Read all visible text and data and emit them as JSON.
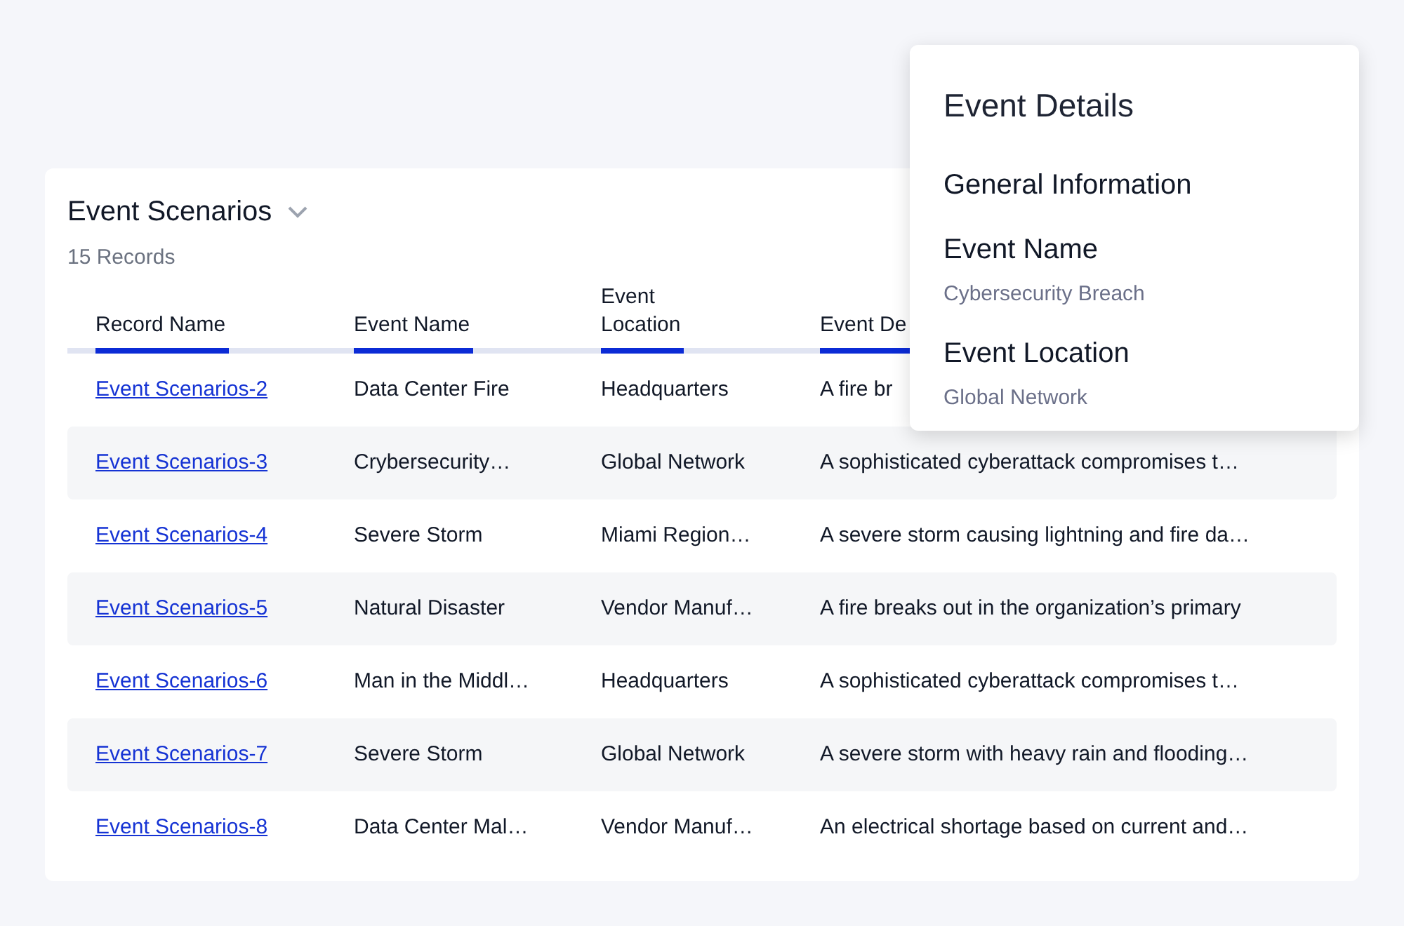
{
  "list": {
    "title": "Event Scenarios",
    "count": "15 Records",
    "columns": [
      "Record Name",
      "Event Name",
      "Event\nLocation",
      "Event De"
    ],
    "rows": [
      {
        "record": "Event Scenarios-2",
        "event_name": "Data Center Fire",
        "location": "Headquarters",
        "description": "A fire br"
      },
      {
        "record": "Event Scenarios-3",
        "event_name": "Crybersecurity…",
        "location": "Global Network",
        "description": "A sophisticated cyberattack compromises t…"
      },
      {
        "record": "Event Scenarios-4",
        "event_name": "Severe Storm",
        "location": "Miami Region…",
        "description": "A severe storm causing lightning and fire da…"
      },
      {
        "record": "Event Scenarios-5",
        "event_name": "Natural Disaster",
        "location": "Vendor Manuf…",
        "description": "A fire breaks out in the organization’s primary"
      },
      {
        "record": "Event Scenarios-6",
        "event_name": "Man in the Middl…",
        "location": "Headquarters",
        "description": "A sophisticated cyberattack compromises t…"
      },
      {
        "record": "Event Scenarios-7",
        "event_name": "Severe Storm",
        "location": "Global Network",
        "description": "A severe storm with heavy rain and flooding…"
      },
      {
        "record": "Event Scenarios-8",
        "event_name": "Data Center Mal…",
        "location": "Vendor Manuf…",
        "description": "An electrical shortage based on current and…"
      }
    ]
  },
  "details": {
    "title": "Event Details",
    "section": "General Information",
    "fields": [
      {
        "label": "Event Name",
        "value": "Cybersecurity Breach"
      },
      {
        "label": "Event Location",
        "value": "Global Network"
      }
    ]
  }
}
